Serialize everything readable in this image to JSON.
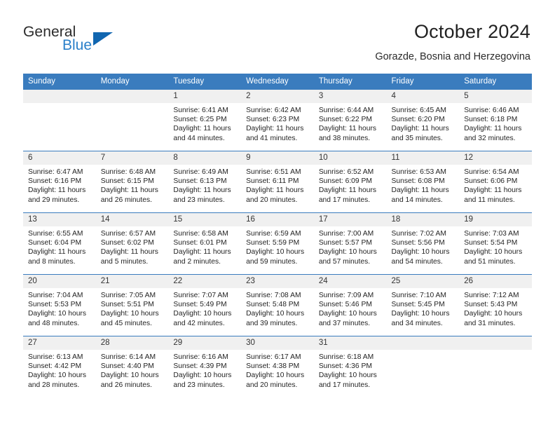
{
  "logo": {
    "primary_text": "General",
    "secondary_text": "Blue",
    "primary_color": "#2b2b2b",
    "secondary_color": "#2a7fc9",
    "triangle_color": "#1166b0"
  },
  "header": {
    "title": "October 2024",
    "subtitle": "Gorazde, Bosnia and Herzegovina"
  },
  "theme": {
    "header_blue": "#3A7CBE",
    "daynum_background": "#F0F0F0",
    "text_color": "#242424"
  },
  "weekday_headers": [
    "Sunday",
    "Monday",
    "Tuesday",
    "Wednesday",
    "Thursday",
    "Friday",
    "Saturday"
  ],
  "weeks": [
    [
      {
        "day": "",
        "empty": true
      },
      {
        "day": "",
        "empty": true
      },
      {
        "day": "1",
        "sunrise": "Sunrise: 6:41 AM",
        "sunset": "Sunset: 6:25 PM",
        "daylight_line1": "Daylight: 11 hours",
        "daylight_line2": "and 44 minutes."
      },
      {
        "day": "2",
        "sunrise": "Sunrise: 6:42 AM",
        "sunset": "Sunset: 6:23 PM",
        "daylight_line1": "Daylight: 11 hours",
        "daylight_line2": "and 41 minutes."
      },
      {
        "day": "3",
        "sunrise": "Sunrise: 6:44 AM",
        "sunset": "Sunset: 6:22 PM",
        "daylight_line1": "Daylight: 11 hours",
        "daylight_line2": "and 38 minutes."
      },
      {
        "day": "4",
        "sunrise": "Sunrise: 6:45 AM",
        "sunset": "Sunset: 6:20 PM",
        "daylight_line1": "Daylight: 11 hours",
        "daylight_line2": "and 35 minutes."
      },
      {
        "day": "5",
        "sunrise": "Sunrise: 6:46 AM",
        "sunset": "Sunset: 6:18 PM",
        "daylight_line1": "Daylight: 11 hours",
        "daylight_line2": "and 32 minutes."
      }
    ],
    [
      {
        "day": "6",
        "sunrise": "Sunrise: 6:47 AM",
        "sunset": "Sunset: 6:16 PM",
        "daylight_line1": "Daylight: 11 hours",
        "daylight_line2": "and 29 minutes."
      },
      {
        "day": "7",
        "sunrise": "Sunrise: 6:48 AM",
        "sunset": "Sunset: 6:15 PM",
        "daylight_line1": "Daylight: 11 hours",
        "daylight_line2": "and 26 minutes."
      },
      {
        "day": "8",
        "sunrise": "Sunrise: 6:49 AM",
        "sunset": "Sunset: 6:13 PM",
        "daylight_line1": "Daylight: 11 hours",
        "daylight_line2": "and 23 minutes."
      },
      {
        "day": "9",
        "sunrise": "Sunrise: 6:51 AM",
        "sunset": "Sunset: 6:11 PM",
        "daylight_line1": "Daylight: 11 hours",
        "daylight_line2": "and 20 minutes."
      },
      {
        "day": "10",
        "sunrise": "Sunrise: 6:52 AM",
        "sunset": "Sunset: 6:09 PM",
        "daylight_line1": "Daylight: 11 hours",
        "daylight_line2": "and 17 minutes."
      },
      {
        "day": "11",
        "sunrise": "Sunrise: 6:53 AM",
        "sunset": "Sunset: 6:08 PM",
        "daylight_line1": "Daylight: 11 hours",
        "daylight_line2": "and 14 minutes."
      },
      {
        "day": "12",
        "sunrise": "Sunrise: 6:54 AM",
        "sunset": "Sunset: 6:06 PM",
        "daylight_line1": "Daylight: 11 hours",
        "daylight_line2": "and 11 minutes."
      }
    ],
    [
      {
        "day": "13",
        "sunrise": "Sunrise: 6:55 AM",
        "sunset": "Sunset: 6:04 PM",
        "daylight_line1": "Daylight: 11 hours",
        "daylight_line2": "and 8 minutes."
      },
      {
        "day": "14",
        "sunrise": "Sunrise: 6:57 AM",
        "sunset": "Sunset: 6:02 PM",
        "daylight_line1": "Daylight: 11 hours",
        "daylight_line2": "and 5 minutes."
      },
      {
        "day": "15",
        "sunrise": "Sunrise: 6:58 AM",
        "sunset": "Sunset: 6:01 PM",
        "daylight_line1": "Daylight: 11 hours",
        "daylight_line2": "and 2 minutes."
      },
      {
        "day": "16",
        "sunrise": "Sunrise: 6:59 AM",
        "sunset": "Sunset: 5:59 PM",
        "daylight_line1": "Daylight: 10 hours",
        "daylight_line2": "and 59 minutes."
      },
      {
        "day": "17",
        "sunrise": "Sunrise: 7:00 AM",
        "sunset": "Sunset: 5:57 PM",
        "daylight_line1": "Daylight: 10 hours",
        "daylight_line2": "and 57 minutes."
      },
      {
        "day": "18",
        "sunrise": "Sunrise: 7:02 AM",
        "sunset": "Sunset: 5:56 PM",
        "daylight_line1": "Daylight: 10 hours",
        "daylight_line2": "and 54 minutes."
      },
      {
        "day": "19",
        "sunrise": "Sunrise: 7:03 AM",
        "sunset": "Sunset: 5:54 PM",
        "daylight_line1": "Daylight: 10 hours",
        "daylight_line2": "and 51 minutes."
      }
    ],
    [
      {
        "day": "20",
        "sunrise": "Sunrise: 7:04 AM",
        "sunset": "Sunset: 5:53 PM",
        "daylight_line1": "Daylight: 10 hours",
        "daylight_line2": "and 48 minutes."
      },
      {
        "day": "21",
        "sunrise": "Sunrise: 7:05 AM",
        "sunset": "Sunset: 5:51 PM",
        "daylight_line1": "Daylight: 10 hours",
        "daylight_line2": "and 45 minutes."
      },
      {
        "day": "22",
        "sunrise": "Sunrise: 7:07 AM",
        "sunset": "Sunset: 5:49 PM",
        "daylight_line1": "Daylight: 10 hours",
        "daylight_line2": "and 42 minutes."
      },
      {
        "day": "23",
        "sunrise": "Sunrise: 7:08 AM",
        "sunset": "Sunset: 5:48 PM",
        "daylight_line1": "Daylight: 10 hours",
        "daylight_line2": "and 39 minutes."
      },
      {
        "day": "24",
        "sunrise": "Sunrise: 7:09 AM",
        "sunset": "Sunset: 5:46 PM",
        "daylight_line1": "Daylight: 10 hours",
        "daylight_line2": "and 37 minutes."
      },
      {
        "day": "25",
        "sunrise": "Sunrise: 7:10 AM",
        "sunset": "Sunset: 5:45 PM",
        "daylight_line1": "Daylight: 10 hours",
        "daylight_line2": "and 34 minutes."
      },
      {
        "day": "26",
        "sunrise": "Sunrise: 7:12 AM",
        "sunset": "Sunset: 5:43 PM",
        "daylight_line1": "Daylight: 10 hours",
        "daylight_line2": "and 31 minutes."
      }
    ],
    [
      {
        "day": "27",
        "sunrise": "Sunrise: 6:13 AM",
        "sunset": "Sunset: 4:42 PM",
        "daylight_line1": "Daylight: 10 hours",
        "daylight_line2": "and 28 minutes."
      },
      {
        "day": "28",
        "sunrise": "Sunrise: 6:14 AM",
        "sunset": "Sunset: 4:40 PM",
        "daylight_line1": "Daylight: 10 hours",
        "daylight_line2": "and 26 minutes."
      },
      {
        "day": "29",
        "sunrise": "Sunrise: 6:16 AM",
        "sunset": "Sunset: 4:39 PM",
        "daylight_line1": "Daylight: 10 hours",
        "daylight_line2": "and 23 minutes."
      },
      {
        "day": "30",
        "sunrise": "Sunrise: 6:17 AM",
        "sunset": "Sunset: 4:38 PM",
        "daylight_line1": "Daylight: 10 hours",
        "daylight_line2": "and 20 minutes."
      },
      {
        "day": "31",
        "sunrise": "Sunrise: 6:18 AM",
        "sunset": "Sunset: 4:36 PM",
        "daylight_line1": "Daylight: 10 hours",
        "daylight_line2": "and 17 minutes."
      },
      {
        "day": "",
        "empty": true
      },
      {
        "day": "",
        "empty": true
      }
    ]
  ]
}
